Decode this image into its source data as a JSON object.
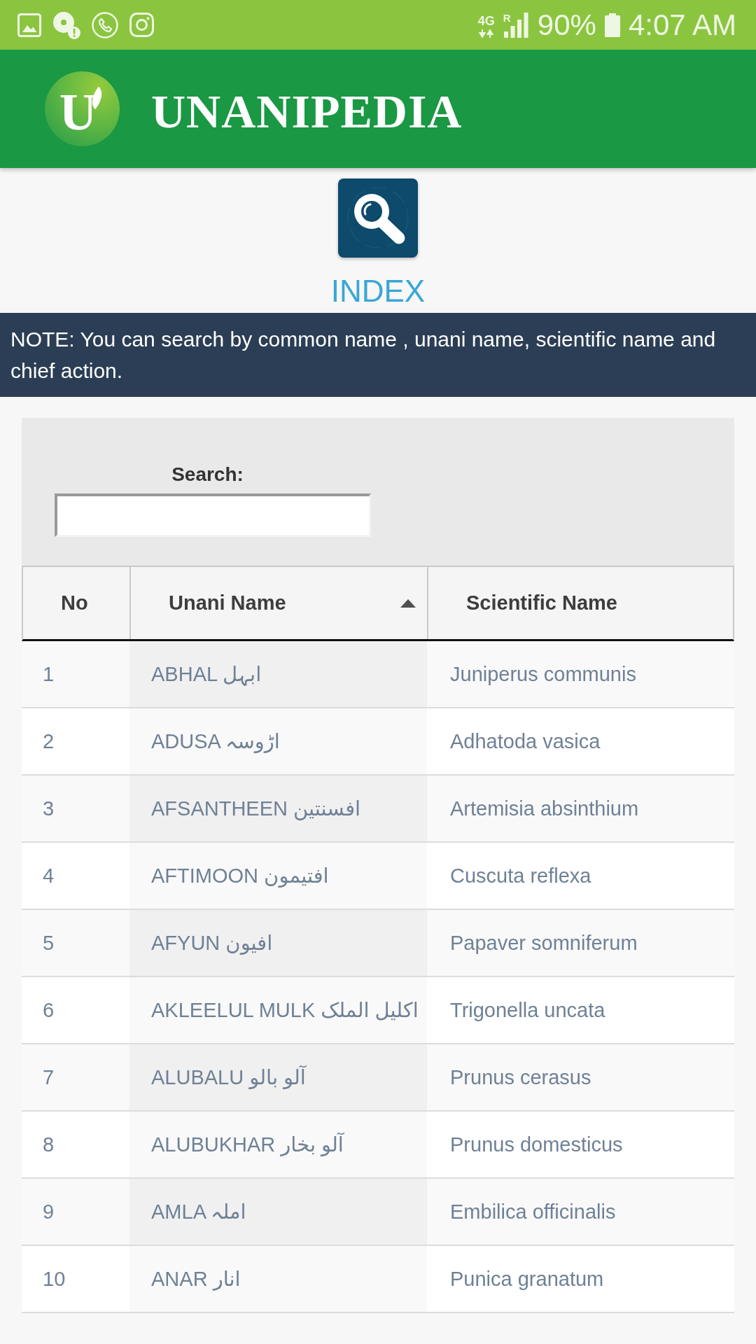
{
  "status_bar": {
    "network": "4G",
    "roaming": "R",
    "battery": "90%",
    "time": "4:07 AM"
  },
  "header": {
    "logo_letter": "U",
    "title": "UNANIPEDIA"
  },
  "page": {
    "heading": "INDEX",
    "note": "NOTE: You can search by common name , unani name, scientific name and chief action."
  },
  "search": {
    "label": "Search:"
  },
  "table": {
    "header": {
      "no": {
        "label": "No",
        "sorted": false
      },
      "unani_name": {
        "label": "Unani Name",
        "sorted": true
      },
      "scientific_name": {
        "label": "Scientific Name",
        "sorted": false
      }
    },
    "rows": [
      {
        "no": "1",
        "unani_name": "ABHAL ابہل",
        "scientific_name": "Juniperus communis"
      },
      {
        "no": "2",
        "unani_name": "ADUSA اڑوسہ",
        "scientific_name": "Adhatoda vasica"
      },
      {
        "no": "3",
        "unani_name": "AFSANTHEEN افسنتین",
        "scientific_name": "Artemisia absinthium"
      },
      {
        "no": "4",
        "unani_name": "AFTIMOON افتیمون",
        "scientific_name": "Cuscuta reflexa"
      },
      {
        "no": "5",
        "unani_name": "AFYUN افیون",
        "scientific_name": "Papaver somniferum"
      },
      {
        "no": "6",
        "unani_name": "AKLEELUL MULK اکلیل الملک",
        "scientific_name": "Trigonella uncata"
      },
      {
        "no": "7",
        "unani_name": "ALUBALU آلو بالو",
        "scientific_name": "Prunus cerasus"
      },
      {
        "no": "8",
        "unani_name": "ALUBUKHAR آلو بخار",
        "scientific_name": "Prunus domesticus"
      },
      {
        "no": "9",
        "unani_name": "AMLA املہ",
        "scientific_name": "Embilica officinalis"
      },
      {
        "no": "10",
        "unani_name": "ANAR انار",
        "scientific_name": "Punica granatum"
      }
    ]
  }
}
